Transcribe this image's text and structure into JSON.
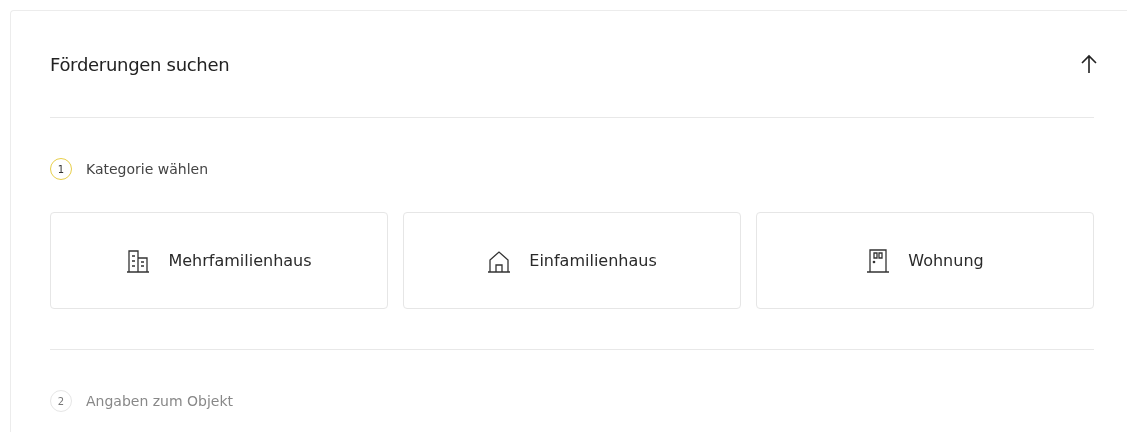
{
  "title": "Förderungen suchen",
  "steps": [
    {
      "number": "1",
      "label": "Kategorie wählen",
      "selected": true
    },
    {
      "number": "2",
      "label": "Angaben zum Objekt",
      "selected": false
    }
  ],
  "categories": [
    {
      "label": "Mehrfamilienhaus",
      "kind": "building"
    },
    {
      "label": "Einfamilienhaus",
      "kind": "house"
    },
    {
      "label": "Wohnung",
      "kind": "door"
    }
  ]
}
